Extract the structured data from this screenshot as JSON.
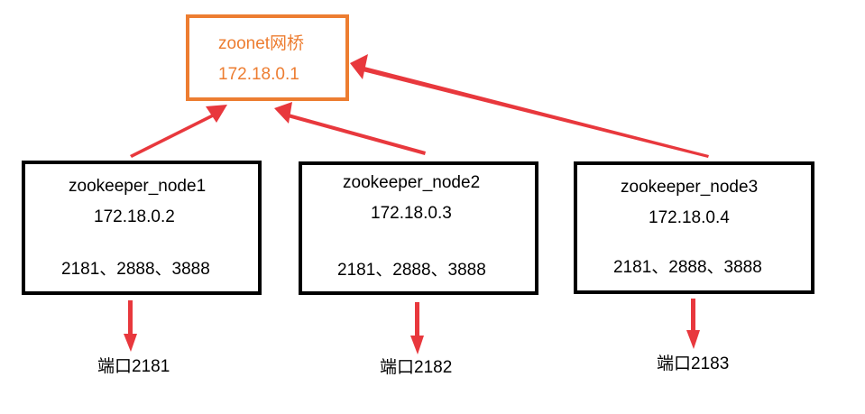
{
  "bridge": {
    "name": "zoonet网桥",
    "ip": "172.18.0.1"
  },
  "nodes": [
    {
      "name": "zookeeper_node1",
      "ip": "172.18.0.2",
      "ports": "2181、2888、3888",
      "host_port": "端口2181"
    },
    {
      "name": "zookeeper_node2",
      "ip": "172.18.0.3",
      "ports": "2181、2888、3888",
      "host_port": "端口2182"
    },
    {
      "name": "zookeeper_node3",
      "ip": "172.18.0.4",
      "ports": "2181、2888、3888",
      "host_port": "端口2183"
    }
  ],
  "colors": {
    "bridge_border": "#ed7d31",
    "bridge_text": "#ed7d31",
    "node_border": "#000000",
    "arrow": "#e8383d"
  }
}
